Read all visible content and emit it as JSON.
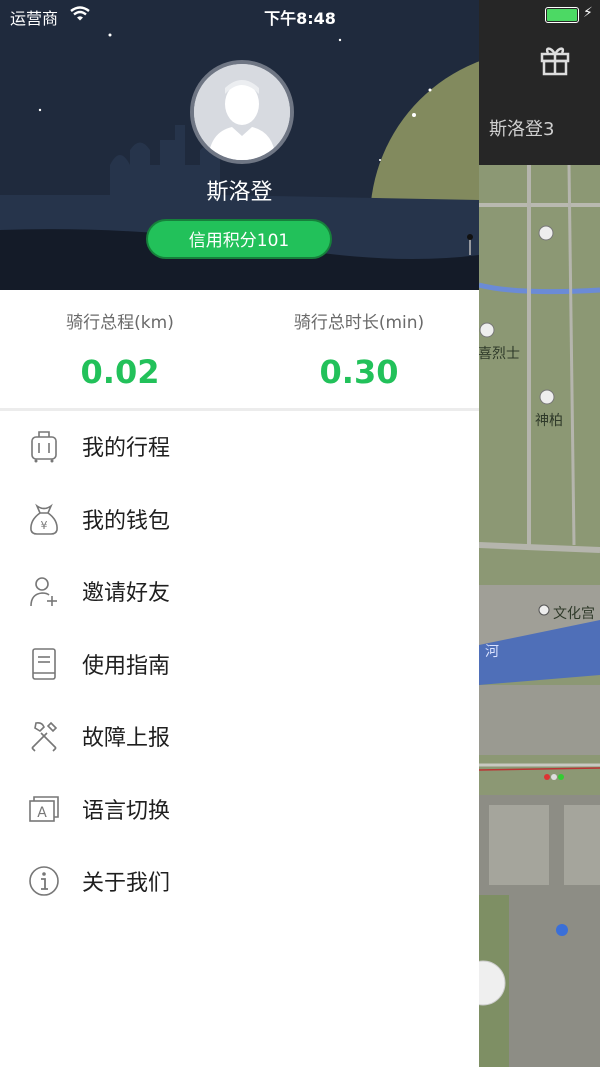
{
  "status_bar": {
    "carrier": "运营商",
    "time": "下午8:48"
  },
  "profile": {
    "name": "斯洛登",
    "credit_label": "信用积分101"
  },
  "stats": [
    {
      "label": "骑行总程(km)",
      "value": "0.02"
    },
    {
      "label": "骑行总时长(min)",
      "value": "0.30"
    }
  ],
  "menu": [
    {
      "label": "我的行程",
      "icon": "luggage-icon"
    },
    {
      "label": "我的钱包",
      "icon": "money-bag-icon"
    },
    {
      "label": "邀请好友",
      "icon": "add-user-icon"
    },
    {
      "label": "使用指南",
      "icon": "book-icon"
    },
    {
      "label": "故障上报",
      "icon": "tools-icon"
    },
    {
      "label": "语言切换",
      "icon": "language-icon"
    },
    {
      "label": "关于我们",
      "icon": "info-icon"
    }
  ],
  "background": {
    "username": "斯洛登3",
    "map_labels": [
      "喜烈士",
      "神柏",
      "文化宫",
      "河"
    ]
  },
  "colors": {
    "accent": "#22c15a",
    "header_bg": "#1f2a3d"
  }
}
